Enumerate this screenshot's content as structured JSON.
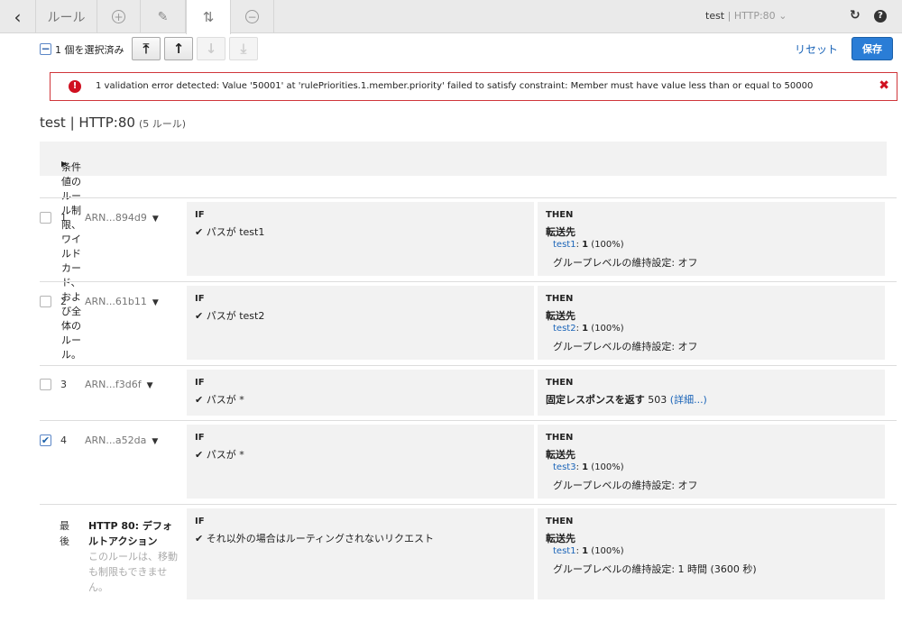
{
  "tabs": {
    "back_glyph": "‹",
    "rules_label": "ルール",
    "add_glyph": "+",
    "edit_glyph": "✎",
    "reorder_glyph": "⇅",
    "remove_glyph": "−"
  },
  "listener": {
    "name": "test",
    "separator": " | ",
    "protocol": "HTTP:80",
    "chevron": "⌄"
  },
  "toolbar": {
    "selected_count": "1 個を選択済み",
    "move_top_glyph": "⤒",
    "move_up_glyph": "↑",
    "move_down_glyph": "↓",
    "move_bottom_glyph": "⤓",
    "reset_label": "リセット",
    "save_label": "保存"
  },
  "error": {
    "message": "1 validation error detected: Value '50001' at 'rulePriorities.1.member.priority' failed to satisfy constraint: Member must have value less than or equal to 50000"
  },
  "page": {
    "title": "test | HTTP:80",
    "rule_count": "(5 ルール)",
    "conditions_note": "条件値のルール制限、ワイルドカード、および全体のルール。"
  },
  "labels": {
    "if": "IF",
    "then": "THEN",
    "forward": "転送先",
    "stickiness": "グループレベルの維持設定: オフ"
  },
  "rules": [
    {
      "num": "1",
      "arn": "ARN...894d9",
      "checked": false,
      "condition": "パスが test1",
      "target": "test1",
      "weight": "1",
      "pct": "(100%)"
    },
    {
      "num": "2",
      "arn": "ARN...61b11",
      "checked": false,
      "condition": "パスが test2",
      "target": "test2",
      "weight": "1",
      "pct": "(100%)"
    },
    {
      "num": "3",
      "arn": "ARN...f3d6f",
      "checked": false,
      "condition": "パスが *",
      "response_label": "固定レスポンスを返す",
      "code": "503",
      "details": "(詳細...)"
    },
    {
      "num": "4",
      "arn": "ARN...a52da",
      "checked": true,
      "condition": "パスが *",
      "target": "test3",
      "weight": "1",
      "pct": "(100%)"
    }
  ],
  "default_rule": {
    "label": "最後",
    "name": "HTTP 80: デフォルトアクション",
    "note": "このルールは、移動も制限もできません。",
    "condition": "それ以外の場合はルーティングされないリクエスト",
    "target": "test1",
    "weight": "1",
    "pct": "(100%)",
    "stickiness": "グループレベルの維持設定: 1 時間 (3600 秒)"
  }
}
